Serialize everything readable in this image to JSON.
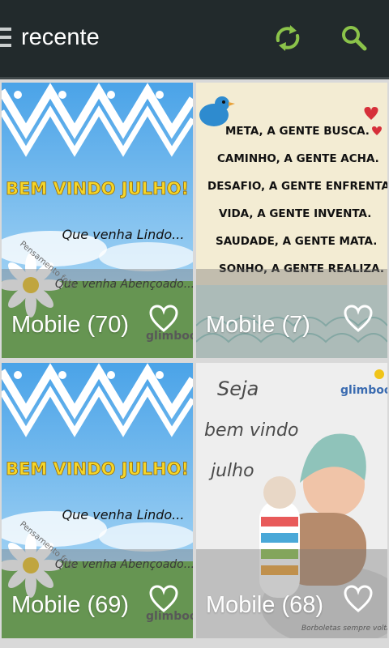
{
  "app_bar": {
    "title": "recente",
    "icons": {
      "menu": "hamburger-icon",
      "refresh": "refresh-icon",
      "search": "search-icon"
    },
    "accent": "#8bc34a",
    "background": "#222a2c"
  },
  "cards": [
    {
      "caption": "Mobile (70)",
      "image": {
        "title_text": "BEM VINDO JULHO!",
        "line1": "Que venha Lindo...",
        "line2": "Que venha Abençoado...",
        "side_text": "Pensamento feliz",
        "brand": "glimboo"
      }
    },
    {
      "caption": "Mobile (7)",
      "image": {
        "lines": [
          "META, A GENTE BUSCA.",
          "CAMINHO, A GENTE ACHA.",
          "DESAFIO, A GENTE ENFRENTA.",
          "VIDA, A GENTE INVENTA.",
          "SAUDADE, A GENTE MATA.",
          "SONHO, A GENTE REALIZA."
        ]
      }
    },
    {
      "caption": "Mobile (69)",
      "image": {
        "title_text": "BEM VINDO JULHO!",
        "line1": "Que venha Lindo...",
        "line2": "Que venha Abençoado...",
        "side_text": "Pensamento feliz",
        "brand": "glimboo"
      }
    },
    {
      "caption": "Mobile (68)",
      "image": {
        "text_lines": [
          "Seja",
          "bem vindo",
          "julho"
        ],
        "brand": "glimboo",
        "footer": "Borboletas sempre voltam"
      }
    }
  ]
}
